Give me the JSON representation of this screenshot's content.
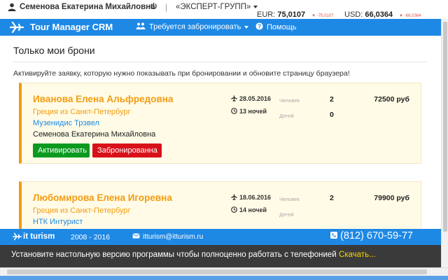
{
  "userbar": {
    "user_name": "Семенова Екатерина Михайловна",
    "separator": "|",
    "agency": "«ЭКСПЕРТ-ГРУПП»",
    "eur_label": "EUR:",
    "eur_value": "75,0107",
    "eur_change": "-75,0107",
    "usd_label": "USD:",
    "usd_value": "66,0364",
    "usd_change": "-66,0364"
  },
  "navbar": {
    "brand": "Tour Manager CRM",
    "book_label": "Требуется забронировать",
    "help_label": "Помощь",
    "color": "#1e88e5"
  },
  "main": {
    "title": "Только мои брони",
    "hint": "Активируйте заявку, которую нужно показывать при бронировании и обновите страницу браузера!",
    "people_label": "Человек",
    "kids_label": "Детей",
    "activate_label": "Активировать",
    "booked_label": "Забронированна",
    "bookings": [
      {
        "name": "Иванова Елена Альфредовна",
        "destination": "Греция из Санкт-Петербург",
        "operator": "Музенидис Трэвел",
        "manager": "Семенова Екатерина Михайловна",
        "date": "28.05.2016",
        "nights": "13 ночей",
        "people": "2",
        "kids": "0",
        "price": "72500 руб"
      },
      {
        "name": "Любомирова Елена Игоревна",
        "destination": "Греция из Санкт-Петербург",
        "operator": "НТК Интурист",
        "date": "18.06.2016",
        "nights": "14 ночей",
        "people": "2",
        "price": "79900 руб"
      }
    ]
  },
  "footer": {
    "brand": "it turism",
    "years": "2008 - 2016",
    "email": "itturism@itturism.ru",
    "phone": "(812) 670-59-77",
    "install_message": "Установите настольную версию программы чтобы полноценно работать с телефонией",
    "download_label": "Скачать..."
  },
  "colors": {
    "accent_blue": "#1e88e5",
    "orange": "#f39c12",
    "green_button": "#0a9a1f",
    "red_button": "#d8101a",
    "change_red": "#d9534f",
    "download_yellow": "#f5d400"
  },
  "icons": {
    "user": "user-icon",
    "power": "power-icon",
    "brand": "plane-logo-icon",
    "book": "users-icon",
    "help": "question-circle-icon",
    "flight": "plane-icon",
    "nights": "clock-icon",
    "email": "envelope-icon",
    "phone": "phone-icon"
  }
}
